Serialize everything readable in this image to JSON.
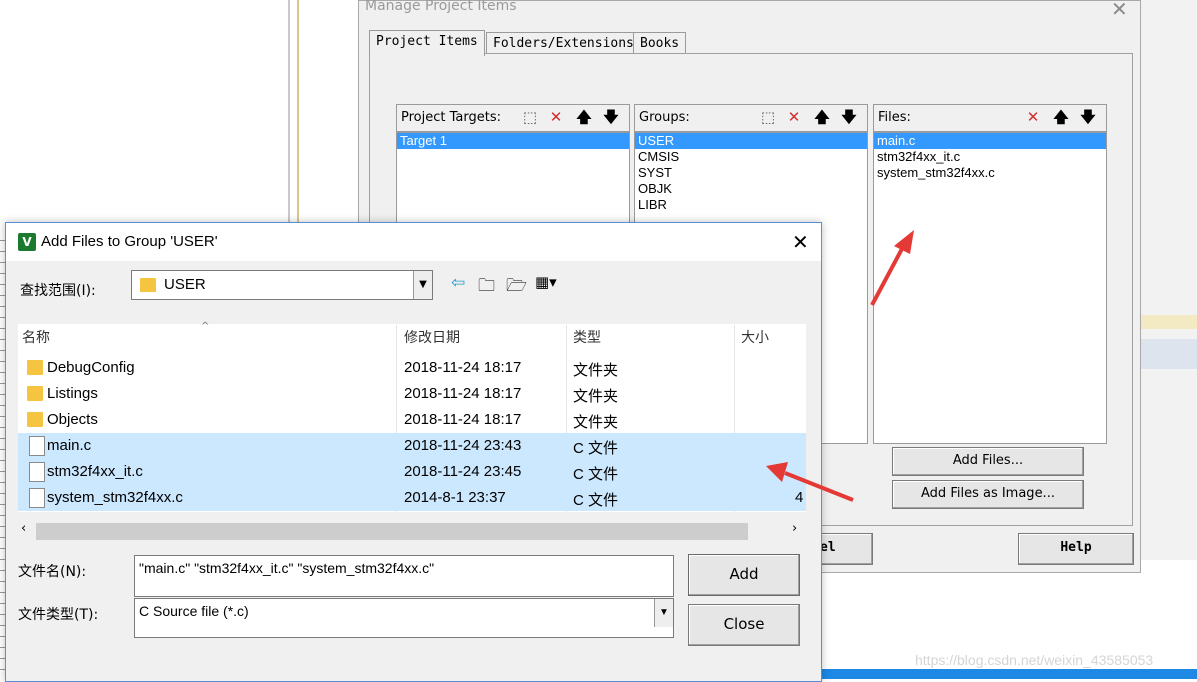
{
  "manage_dialog": {
    "title": "Manage Project Items",
    "tabs": [
      "Project Items",
      "Folders/Extensions",
      "Books"
    ],
    "targets_label": "Project Targets:",
    "targets": [
      "Target 1"
    ],
    "groups_label": "Groups:",
    "groups": [
      "USER",
      "CMSIS",
      "SYST",
      "OBJK",
      "LIBR"
    ],
    "files_label": "Files:",
    "files": [
      "main.c",
      "stm32f4xx_it.c",
      "system_stm32f4xx.c"
    ],
    "add_files_label": "Add Files...",
    "add_files_image_label": "Add Files as Image...",
    "cancel_partial": "el",
    "help_label": "Help"
  },
  "add_dialog": {
    "title": "Add Files to Group 'USER'",
    "lookin_label": "查找范围(I):",
    "lookin_value": "USER",
    "columns": [
      "名称",
      "修改日期",
      "类型",
      "大小"
    ],
    "rows": [
      {
        "name": "DebugConfig",
        "date": "2018-11-24 18:17",
        "type": "文件夹",
        "size": "",
        "kind": "folder",
        "selected": false
      },
      {
        "name": "Listings",
        "date": "2018-11-24 18:17",
        "type": "文件夹",
        "size": "",
        "kind": "folder",
        "selected": false
      },
      {
        "name": "Objects",
        "date": "2018-11-24 18:17",
        "type": "文件夹",
        "size": "",
        "kind": "folder",
        "selected": false
      },
      {
        "name": "main.c",
        "date": "2018-11-24 23:43",
        "type": "C 文件",
        "size": "",
        "kind": "file",
        "selected": true
      },
      {
        "name": "stm32f4xx_it.c",
        "date": "2018-11-24 23:45",
        "type": "C 文件",
        "size": "",
        "kind": "file",
        "selected": true
      },
      {
        "name": "system_stm32f4xx.c",
        "date": "2014-8-1 23:37",
        "type": "C 文件",
        "size": "4",
        "kind": "file",
        "selected": true
      }
    ],
    "filename_label": "文件名(N):",
    "filename_value": "\"main.c\" \"stm32f4xx_it.c\" \"system_stm32f4xx.c\"",
    "filetype_label": "文件类型(T):",
    "filetype_value": "C Source file (*.c)",
    "add_label": "Add",
    "close_label": "Close"
  },
  "watermark": "https://blog.csdn.net/weixin_43585053",
  "colors": {
    "selection": "#3399ff",
    "row_selected": "#cce8ff",
    "arrow": "#e53935",
    "delete_red": "#d32f2f"
  }
}
